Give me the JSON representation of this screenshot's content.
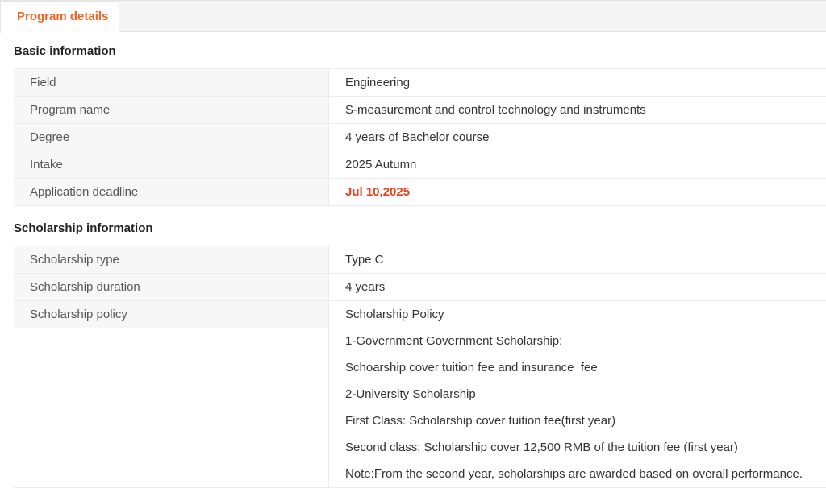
{
  "tabs": [
    {
      "label": "Program details",
      "active": true
    }
  ],
  "accent_color": "#f26522",
  "deadline_color": "#e8401c",
  "basic_information": {
    "title": "Basic information",
    "rows": [
      {
        "label": "Field",
        "value": "Engineering"
      },
      {
        "label": "Program name",
        "value": "S-measurement and control technology and instruments"
      },
      {
        "label": "Degree",
        "value": "4 years of Bachelor course"
      },
      {
        "label": "Intake",
        "value": "2025 Autumn"
      },
      {
        "label": "Application deadline",
        "value": "Jul 10,2025"
      }
    ]
  },
  "scholarship_information": {
    "title": "Scholarship information",
    "rows": [
      {
        "label": "Scholarship type",
        "value": "Type C"
      },
      {
        "label": "Scholarship duration",
        "value": "4 years"
      }
    ],
    "policy": {
      "label": "Scholarship policy",
      "lines": [
        "Scholarship Policy",
        "1-Government Government Scholarship:",
        "Schoarship cover tuition fee and insurance  fee",
        "2-University Scholarship",
        "First Class: Scholarship cover tuition fee(first year)",
        "Second class: Scholarship cover 12,500 RMB of the tuition fee (first year)",
        "Note:From the second year, scholarships are awarded based on overall performance."
      ]
    }
  }
}
